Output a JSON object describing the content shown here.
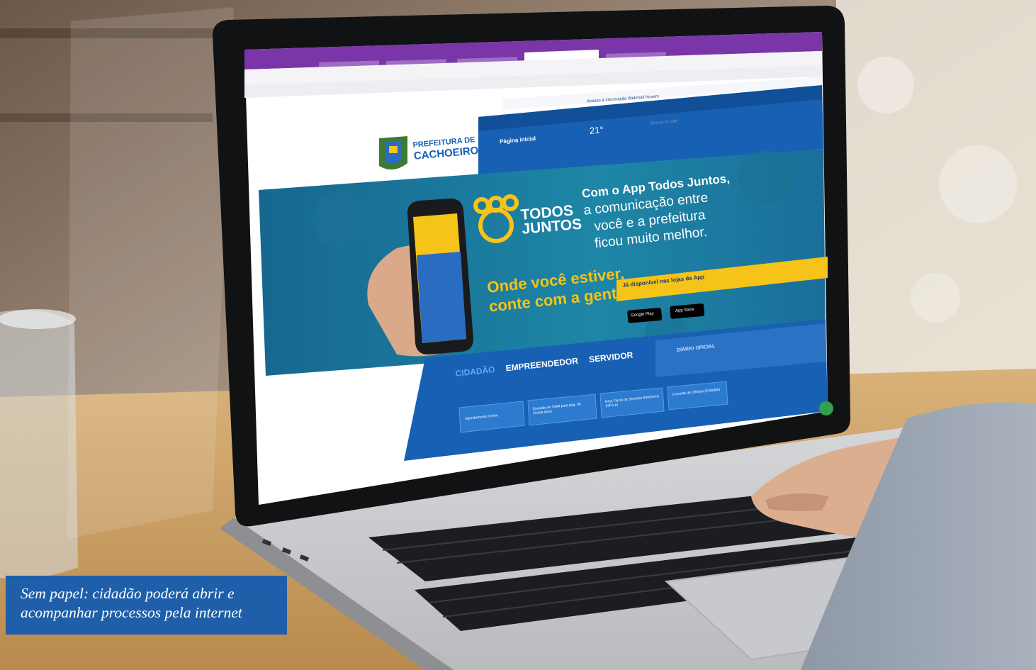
{
  "caption": {
    "line1": "Sem papel: cidadão poderá abrir e",
    "line2": "acompanhar processos pela internet"
  },
  "site": {
    "logo_line1": "PREFEITURA DE",
    "logo_line2": "CACHOEIRO",
    "home_link": "Página inicial",
    "temperature": "21°",
    "search_placeholder": "Buscar no site",
    "accessibility_links": [
      "Acesso à Informação",
      "Webmail",
      "Nuvem"
    ]
  },
  "banner": {
    "app_name_line1": "TODOS",
    "app_name_line2": "JUNTOS",
    "headline_bold": "Com o App Todos Juntos,",
    "headline_rest": [
      "a comunicação entre",
      "você e a prefeitura",
      "ficou muito melhor."
    ],
    "slogan_line1": "Onde você estiver,",
    "slogan_line2": "conte com a gente!",
    "cta": "Já disponível nas lojas de App",
    "store_google": "Google Play",
    "store_apple": "App Store"
  },
  "services": {
    "tabs": [
      "CIDADÃO",
      "EMPREENDEDOR",
      "SERVIDOR"
    ],
    "diario": "DIÁRIO OFICIAL",
    "cards": [
      "Agendamento Online",
      "Emissão de DAM para pag. de Dívida Ativa",
      "Nota Fiscal de Serviços Eletrônica (NFS-e)",
      "Consulta de Débitos (Cidadão)"
    ]
  },
  "colors": {
    "caption_bg": "#1f5ea8",
    "site_blue": "#1760b4",
    "banner_teal": "#1e7fa0",
    "accent_yellow": "#f6c318",
    "browser_purple": "#7a36a8"
  }
}
